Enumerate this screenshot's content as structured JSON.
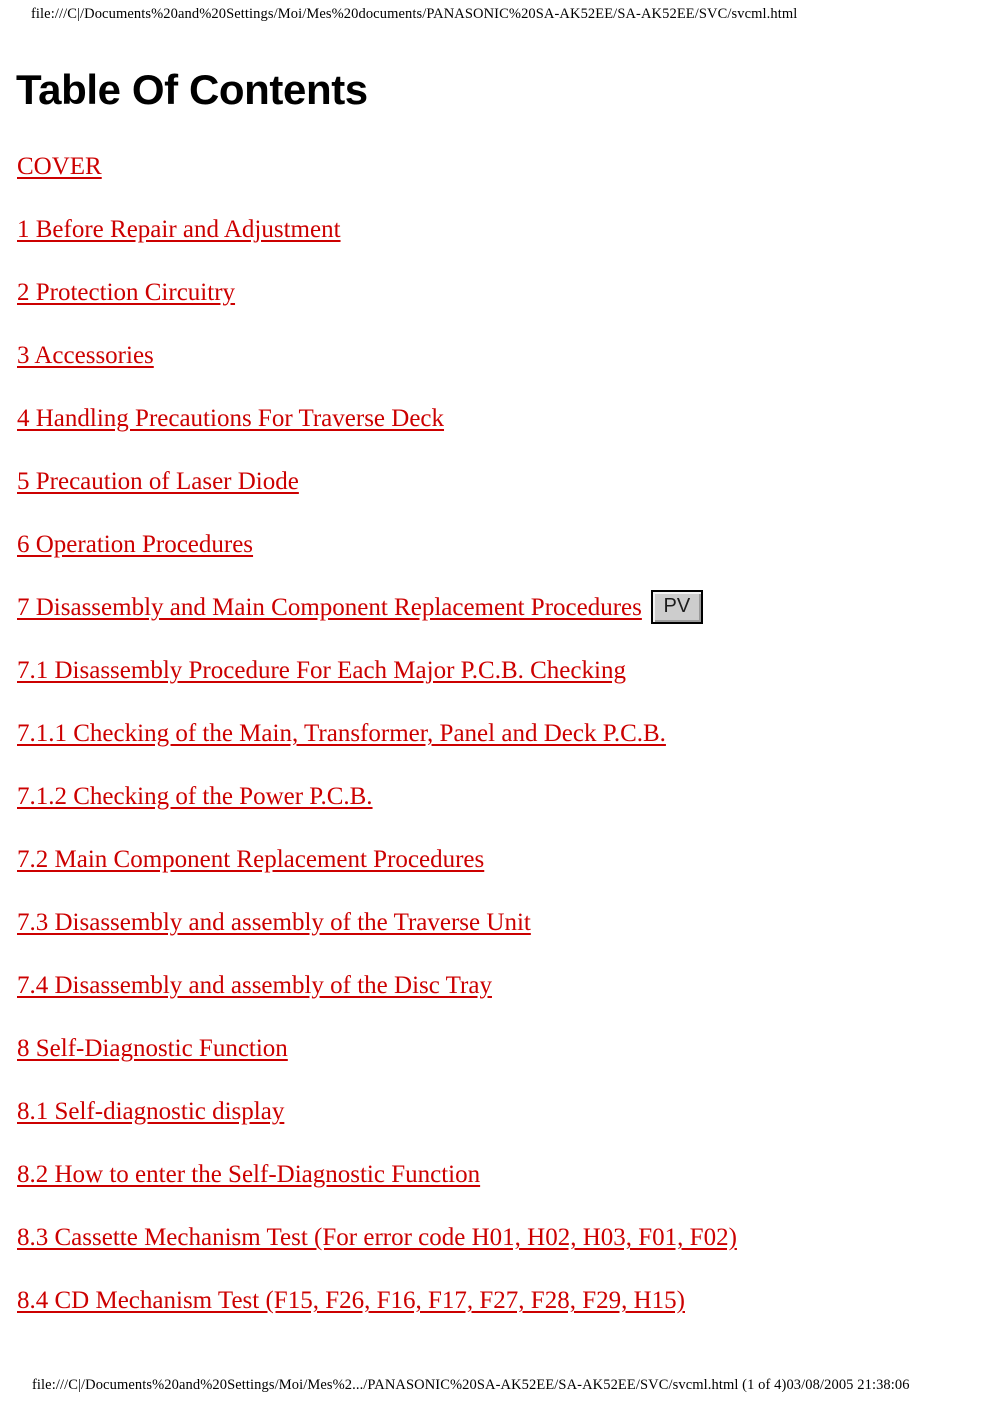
{
  "page": {
    "header_url": "file:///C|/Documents%20and%20Settings/Moi/Mes%20documents/PANASONIC%20SA-AK52EE/SA-AK52EE/SVC/svcml.html",
    "title": "Table Of Contents",
    "footer_url": "file:///C|/Documents%20and%20Settings/Moi/Mes%2.../PANASONIC%20SA-AK52EE/SA-AK52EE/SVC/svcml.html (1 of 4)03/08/2005 21:38:06",
    "link_color": "#cc0000",
    "background_color": "#ffffff",
    "text_color": "#000000"
  },
  "toc": {
    "entries": [
      {
        "label": "COVER"
      },
      {
        "label": "1 Before Repair and Adjustment"
      },
      {
        "label": "2 Protection Circuitry"
      },
      {
        "label": "3 Accessories"
      },
      {
        "label": "4 Handling Precautions For Traverse Deck"
      },
      {
        "label": "5 Precaution of Laser Diode"
      },
      {
        "label": "6 Operation Procedures"
      },
      {
        "label": "7 Disassembly and Main Component Replacement Procedures",
        "badge": "PV"
      },
      {
        "label": "7.1 Disassembly Procedure For Each Major P.C.B. Checking"
      },
      {
        "label": "7.1.1 Checking of the Main, Transformer, Panel and Deck P.C.B."
      },
      {
        "label": "7.1.2 Checking of the Power P.C.B."
      },
      {
        "label": "7.2 Main Component Replacement Procedures"
      },
      {
        "label": "7.3 Disassembly and assembly of the Traverse Unit"
      },
      {
        "label": "7.4 Disassembly and assembly of the Disc Tray"
      },
      {
        "label": "8 Self-Diagnostic Function"
      },
      {
        "label": "8.1 Self-diagnostic display"
      },
      {
        "label": "8.2 How to enter the Self-Diagnostic Function"
      },
      {
        "label": "8.3 Cassette Mechanism Test (For error code H01, H02, H03, F01, F02)"
      },
      {
        "label": "8.4 CD Mechanism Test (F15, F26, F16, F17, F27, F28, F29, H15)"
      }
    ]
  }
}
